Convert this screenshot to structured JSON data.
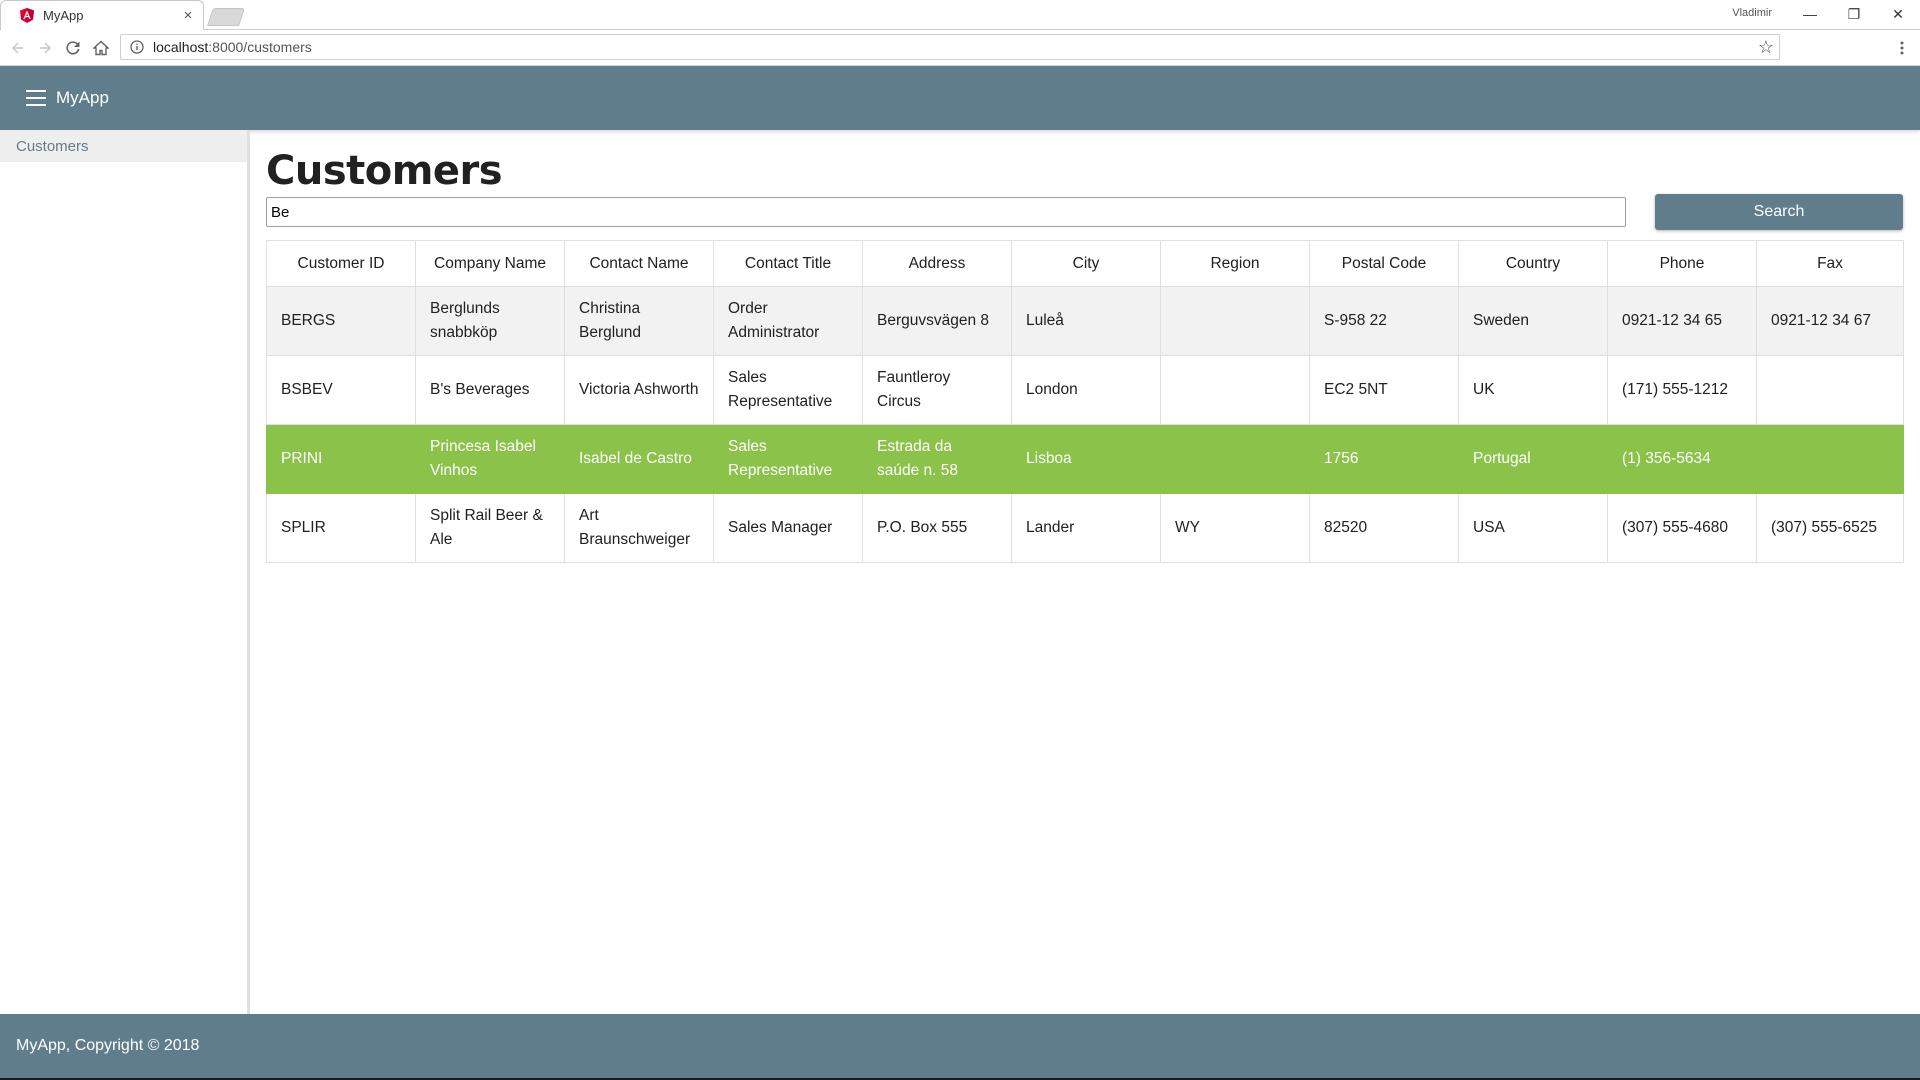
{
  "browser": {
    "tab_title": "MyApp",
    "tab_close": "×",
    "user_name": "Vladimir",
    "url_host": "localhost",
    "url_rest": ":8000/customers",
    "window_controls": {
      "minimize": "—",
      "restore": "❐",
      "close": "✕"
    },
    "star": "☆"
  },
  "header": {
    "app_title": "MyApp"
  },
  "sidebar": {
    "items": [
      {
        "label": "Customers"
      }
    ]
  },
  "main": {
    "title": "Customers",
    "search": {
      "value": "Be",
      "button_label": "Search"
    },
    "table": {
      "columns": [
        "Customer ID",
        "Company Name",
        "Contact Name",
        "Contact Title",
        "Address",
        "City",
        "Region",
        "Postal Code",
        "Country",
        "Phone",
        "Fax"
      ],
      "rows": [
        {
          "style": "alt",
          "cells": [
            "BERGS",
            "Berglunds snabbköp",
            "Christina Berglund",
            "Order Administrator",
            "Berguvsvägen 8",
            "Luleå",
            "",
            "S-958 22",
            "Sweden",
            "0921-12 34 65",
            "0921-12 34 67"
          ]
        },
        {
          "style": "plain",
          "cells": [
            "BSBEV",
            "B's Beverages",
            "Victoria Ashworth",
            "Sales Representative",
            "Fauntleroy Circus",
            "London",
            "",
            "EC2 5NT",
            "UK",
            "(171) 555-1212",
            ""
          ]
        },
        {
          "style": "selected",
          "cells": [
            "PRINI",
            "Princesa Isabel Vinhos",
            "Isabel de Castro",
            "Sales Representative",
            "Estrada da saúde n. 58",
            "Lisboa",
            "",
            "1756",
            "Portugal",
            "(1) 356-5634",
            ""
          ]
        },
        {
          "style": "plain",
          "cells": [
            "SPLIR",
            "Split Rail Beer & Ale",
            "Art Braunschweiger",
            "Sales Manager",
            "P.O. Box 555",
            "Lander",
            "WY",
            "82520",
            "USA",
            "(307) 555-4680",
            "(307) 555-6525"
          ]
        }
      ]
    }
  },
  "footer": {
    "text": "MyApp, Copyright © 2018"
  },
  "colors": {
    "primary": "#607d8b",
    "selected_row": "#8bc34a",
    "alt_row": "#f2f2f2"
  },
  "icons": [
    "angular-icon",
    "back-arrow-icon",
    "forward-arrow-icon",
    "reload-icon",
    "home-icon",
    "info-icon",
    "star-icon",
    "menu-dots-icon",
    "hamburger-icon"
  ]
}
